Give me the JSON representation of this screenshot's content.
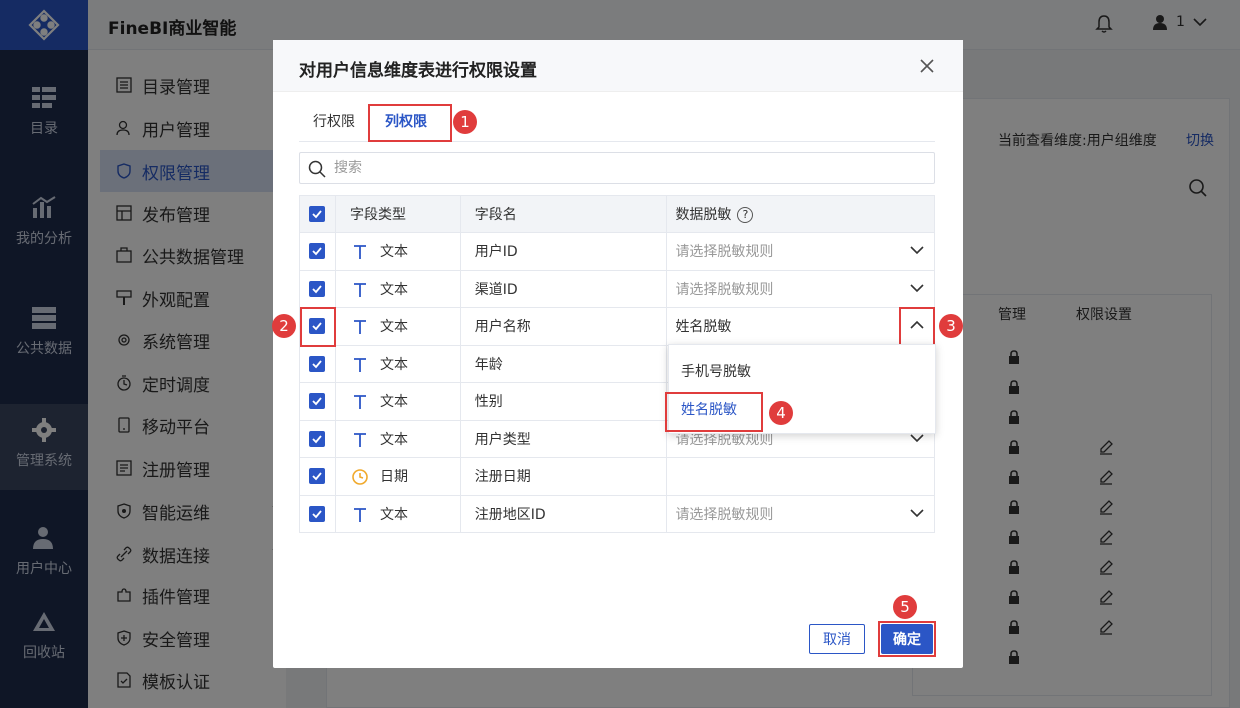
{
  "app": {
    "title": "FineBI商业智能"
  },
  "topbar": {
    "user": "1"
  },
  "rail": {
    "items": [
      {
        "label": "目录",
        "icon": "catalog-icon"
      },
      {
        "label": "我的分析",
        "icon": "analysis-icon"
      },
      {
        "label": "公共数据",
        "icon": "public-data-icon"
      },
      {
        "label": "管理系统",
        "icon": "gear-icon"
      },
      {
        "label": "用户中心",
        "icon": "user-icon"
      },
      {
        "label": "回收站",
        "icon": "recycle-icon"
      }
    ]
  },
  "menu": {
    "items": [
      {
        "label": "目录管理"
      },
      {
        "label": "用户管理"
      },
      {
        "label": "权限管理"
      },
      {
        "label": "发布管理"
      },
      {
        "label": "公共数据管理"
      },
      {
        "label": "外观配置"
      },
      {
        "label": "系统管理"
      },
      {
        "label": "定时调度"
      },
      {
        "label": "移动平台"
      },
      {
        "label": "注册管理"
      },
      {
        "label": "智能运维"
      },
      {
        "label": "数据连接"
      },
      {
        "label": "插件管理"
      },
      {
        "label": "安全管理"
      },
      {
        "label": "模板认证"
      }
    ]
  },
  "background": {
    "dimension_text": "当前查看维度:用户组维度",
    "switch_label": "切换",
    "col_manage": "管理",
    "col_permission": "权限设置"
  },
  "dialog": {
    "title": "对用户信息维度表进行权限设置",
    "tabs": [
      {
        "label": "行权限"
      },
      {
        "label": "列权限"
      }
    ],
    "search_placeholder": "搜索",
    "headers": {
      "type": "字段类型",
      "name": "字段名",
      "mask": "数据脱敏",
      "help": "?"
    },
    "rows": [
      {
        "type": "文本",
        "name": "用户ID",
        "mask": "请选择脱敏规则",
        "placeholder": true
      },
      {
        "type": "文本",
        "name": "渠道ID",
        "mask": "请选择脱敏规则",
        "placeholder": true
      },
      {
        "type": "文本",
        "name": "用户名称",
        "mask": "姓名脱敏",
        "placeholder": false
      },
      {
        "type": "文本",
        "name": "年龄",
        "mask": "",
        "placeholder": false
      },
      {
        "type": "文本",
        "name": "性别",
        "mask": "",
        "placeholder": false
      },
      {
        "type": "文本",
        "name": "用户类型",
        "mask": "请选择脱敏规则",
        "placeholder": true
      },
      {
        "type": "日期",
        "name": "注册日期",
        "mask": "",
        "placeholder": false
      },
      {
        "type": "文本",
        "name": "注册地区ID",
        "mask": "请选择脱敏规则",
        "placeholder": true
      }
    ],
    "dropdown": [
      {
        "label": "手机号脱敏"
      },
      {
        "label": "姓名脱敏"
      }
    ],
    "cancel_label": "取消",
    "ok_label": "确定"
  },
  "steps": [
    "1",
    "2",
    "3",
    "4",
    "5"
  ],
  "colors": {
    "accent": "#2b56c6",
    "rail": "#1f2d4d",
    "marker": "#e03c3c",
    "date_icon": "#f0a92c"
  }
}
